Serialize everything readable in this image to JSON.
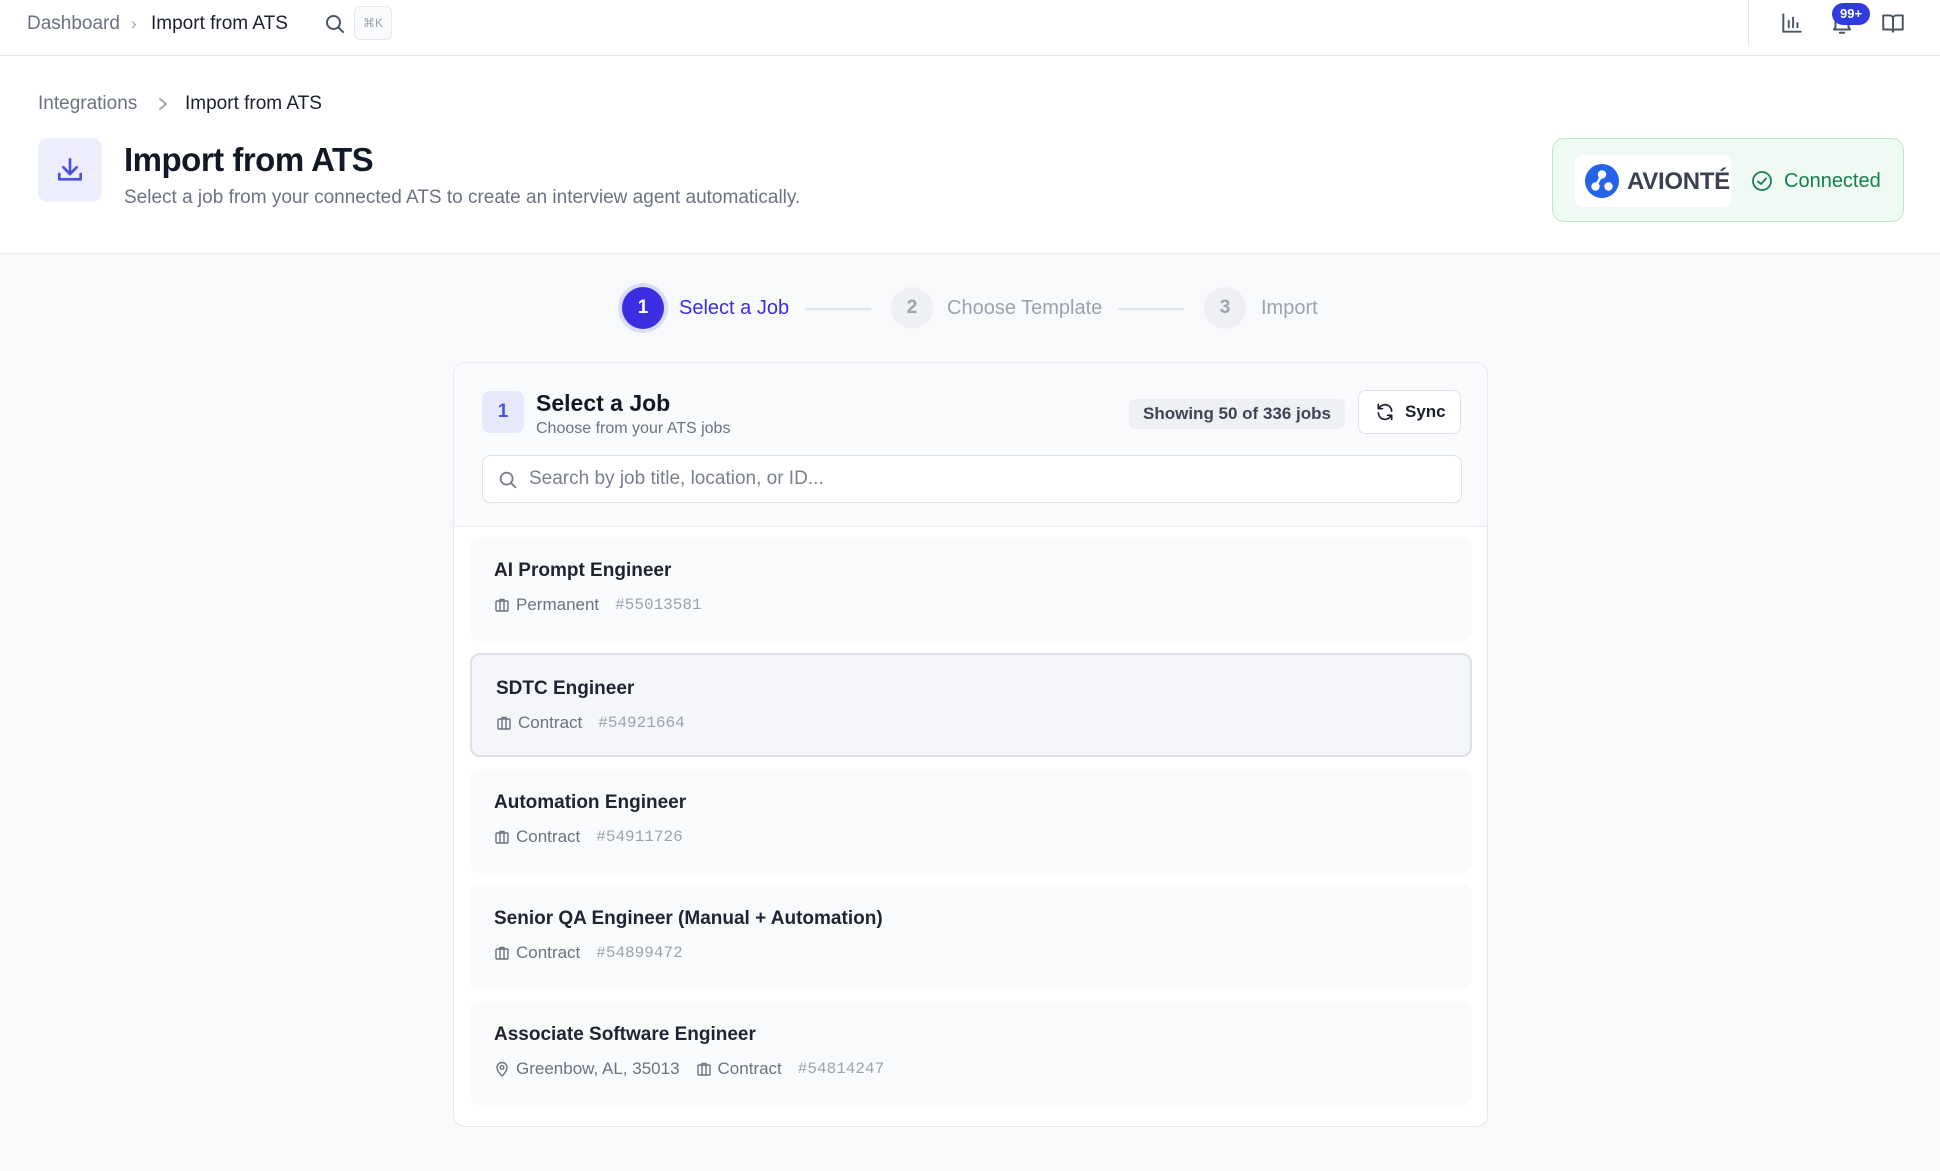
{
  "topbar": {
    "crumb_dashboard": "Dashboard",
    "crumb_separator": "›",
    "crumb_current": "Import from ATS",
    "search_shortcut": "⌘K",
    "notifications_badge": "99+"
  },
  "header": {
    "breadcrumb_parent": "Integrations",
    "breadcrumb_current": "Import from ATS",
    "title": "Import from ATS",
    "subtitle": "Select a job from your connected ATS to create an interview agent automatically.",
    "provider_name": "AVIONTÉ",
    "connection_status": "Connected",
    "accent_color": "#3b2ee0",
    "status_color": "#17804a"
  },
  "stepper": {
    "steps": [
      {
        "number": "1",
        "label": "Select a Job",
        "state": "active"
      },
      {
        "number": "2",
        "label": "Choose Template",
        "state": "inactive"
      },
      {
        "number": "3",
        "label": "Import",
        "state": "inactive"
      }
    ]
  },
  "job_card": {
    "step_number": "1",
    "title": "Select a Job",
    "subtitle": "Choose from your ATS jobs",
    "count_label": "Showing 50 of 336 jobs",
    "sync_label": "Sync",
    "search_placeholder": "Search by job title, location, or ID...",
    "search_value": ""
  },
  "jobs": [
    {
      "title": "AI Prompt Engineer",
      "location": "",
      "type": "Permanent",
      "id": "#55013581",
      "selected": false
    },
    {
      "title": "SDTC Engineer",
      "location": "",
      "type": "Contract",
      "id": "#54921664",
      "selected": true
    },
    {
      "title": "Automation Engineer",
      "location": "",
      "type": "Contract",
      "id": "#54911726",
      "selected": false
    },
    {
      "title": "Senior QA Engineer (Manual + Automation)",
      "location": "",
      "type": "Contract",
      "id": "#54899472",
      "selected": false
    },
    {
      "title": "Associate Software Engineer",
      "location": "Greenbow, AL, 35013",
      "type": "Contract",
      "id": "#54814247",
      "selected": false
    }
  ]
}
